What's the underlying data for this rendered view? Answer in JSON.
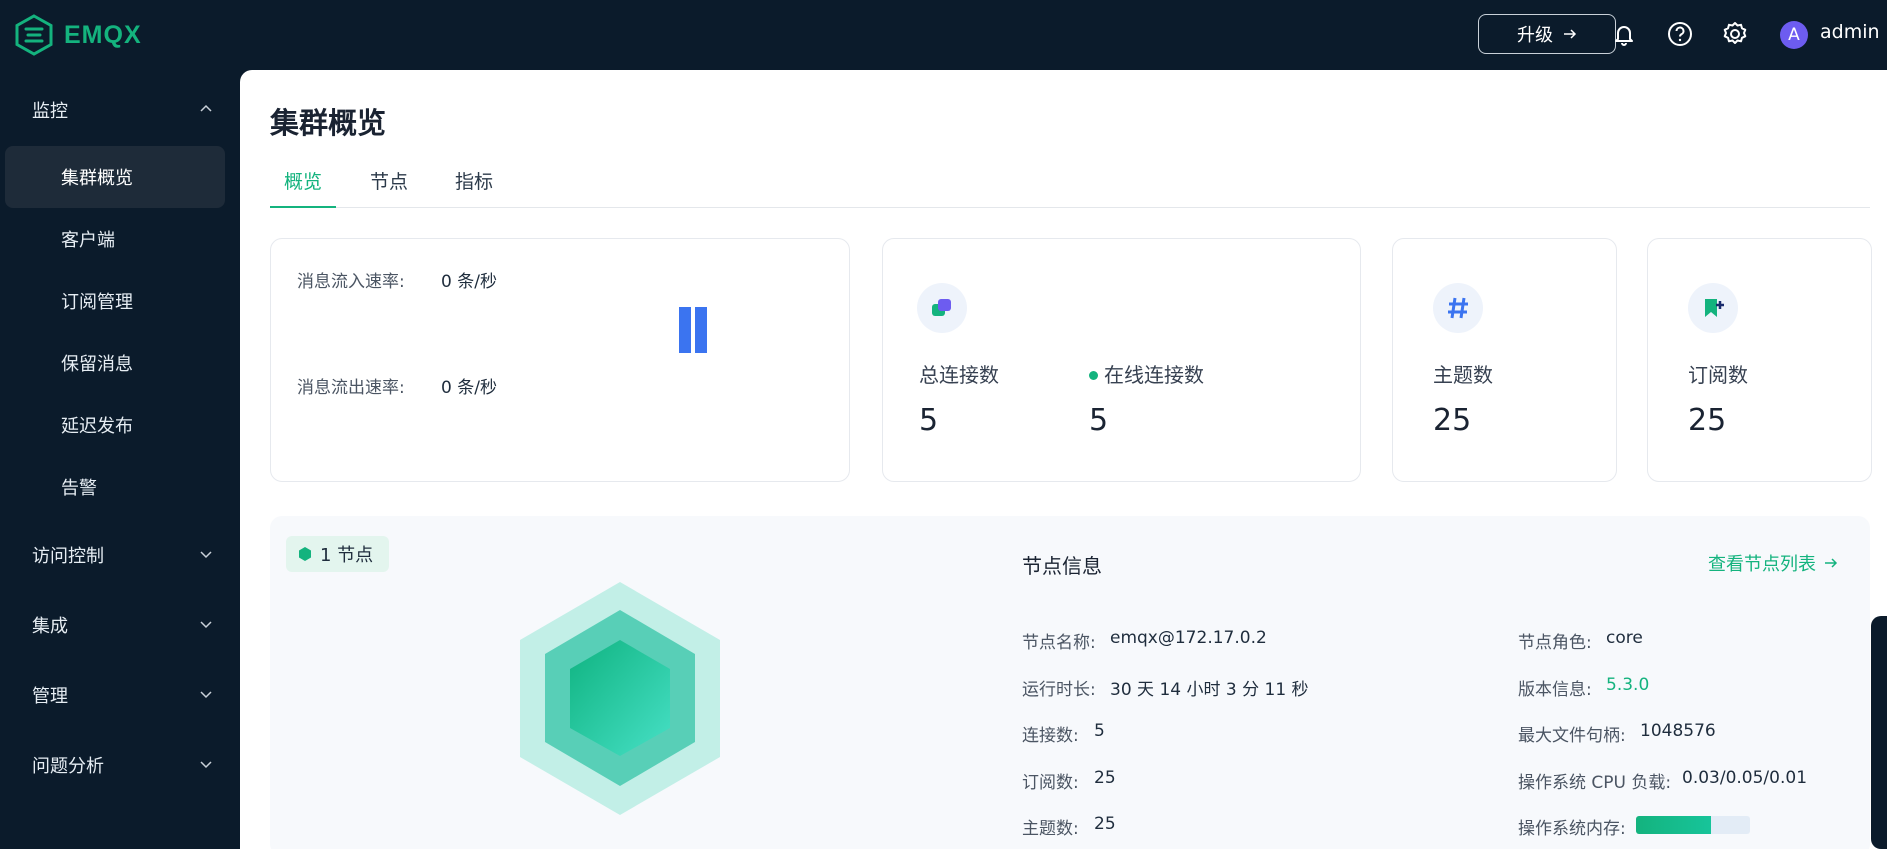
{
  "brand": {
    "name": "EMQX"
  },
  "header": {
    "upgrade_label": "升级",
    "username": "admin",
    "avatar_letter": "A"
  },
  "sidebar": {
    "groups": [
      {
        "label": "监控",
        "expanded": true
      },
      {
        "label": "访问控制",
        "expanded": false
      },
      {
        "label": "集成",
        "expanded": false
      },
      {
        "label": "管理",
        "expanded": false
      },
      {
        "label": "问题分析",
        "expanded": false
      }
    ],
    "monitor_items": [
      {
        "label": "集群概览",
        "active": true
      },
      {
        "label": "客户端",
        "active": false
      },
      {
        "label": "订阅管理",
        "active": false
      },
      {
        "label": "保留消息",
        "active": false
      },
      {
        "label": "延迟发布",
        "active": false
      },
      {
        "label": "告警",
        "active": false
      }
    ]
  },
  "main": {
    "title": "集群概览",
    "tabs": [
      {
        "label": "概览",
        "active": true
      },
      {
        "label": "节点",
        "active": false
      },
      {
        "label": "指标",
        "active": false
      }
    ],
    "rates": {
      "in_label": "消息流入速率:",
      "in_value": "0 条/秒",
      "out_label": "消息流出速率:",
      "out_value": "0 条/秒"
    },
    "connections": {
      "total_label": "总连接数",
      "total_value": "5",
      "online_label": "在线连接数",
      "online_value": "5"
    },
    "topics": {
      "label": "主题数",
      "value": "25"
    },
    "subscriptions": {
      "label": "订阅数",
      "value": "25"
    },
    "node": {
      "badge": "1 节点",
      "info_title": "节点信息",
      "view_list_link": "查看节点列表",
      "name_label": "节点名称:",
      "name_value": "emqx@172.17.0.2",
      "uptime_label": "运行时长:",
      "uptime_value": "30 天 14 小时 3 分 11 秒",
      "connections_label": "连接数:",
      "connections_value": "5",
      "subscriptions_label": "订阅数:",
      "subscriptions_value": "25",
      "topics_label": "主题数:",
      "topics_value": "25",
      "role_label": "节点角色:",
      "role_value": "core",
      "version_label": "版本信息:",
      "version_value": "5.3.0",
      "max_fd_label": "最大文件句柄:",
      "max_fd_value": "1048576",
      "cpu_load_label": "操作系统 CPU 负载:",
      "cpu_load_value": "0.03/0.05/0.01",
      "memory_label": "操作系统内存:",
      "memory_fraction": 0.66
    }
  },
  "colors": {
    "accent": "#14b37e",
    "sidebar_bg": "#0b1b2b",
    "active_item_bg": "#1e2b39",
    "avatar": "#6d5cf0"
  }
}
